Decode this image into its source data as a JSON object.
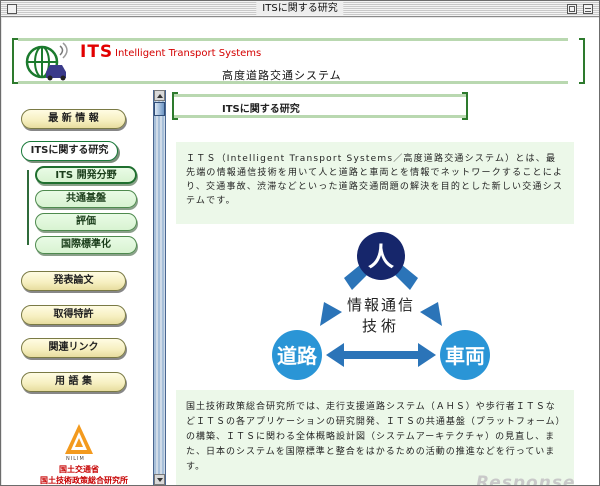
{
  "window": {
    "title": "ITSに関する研究"
  },
  "header": {
    "mark": "ITS",
    "full_name": "Intelligent Transport Systems",
    "subtitle": "高度道路交通システム"
  },
  "nav": {
    "items": [
      {
        "label": "最 新 情 報"
      },
      {
        "label": "ITSに関する研究"
      },
      {
        "label": "発表論文"
      },
      {
        "label": "取得特許"
      },
      {
        "label": "関連リンク"
      },
      {
        "label": "用 語 集"
      }
    ],
    "sub_items": [
      {
        "label": "ITS 開発分野"
      },
      {
        "label": "共通基盤"
      },
      {
        "label": "評価"
      },
      {
        "label": "国際標準化"
      }
    ],
    "org": {
      "logo_text": "NILIM",
      "line1": "国土交通省",
      "line2": "国土技術政策総合研究所"
    }
  },
  "main": {
    "section_title": "ITSに関する研究",
    "intro": "ＩＴＳ（Intelligent Transport Systems／高度道路交通システム）とは、最先端の情報通信技術を用いて人と道路と車両とを情報でネットワークすることにより、交通事故、渋滞などといった道路交通問題の解決を目的とした新しい交通システムです。",
    "diagram": {
      "top": "人",
      "left": "道路",
      "right": "車両",
      "center_line1": "情報通信",
      "center_line2": "技術",
      "colors": {
        "top": "#16266b",
        "sides": "#2a95d6",
        "arrows": "#2b74b8"
      }
    },
    "description": "国土技術政策総合研究所では、走行支援道路システム（ＡＨＳ）や歩行者ＩＴＳなどＩＴＳの各アプリケーションの研究開発、ＩＴＳの共通基盤（プラットフォーム）の構築、ＩＴＳに関わる全体概略設計図（システムアーキテクチャ）の見直し、また、日本のシステムを国際標準と整合をはかるための活動の推進などを行っています。"
  },
  "watermark": "Response",
  "colors": {
    "brand_red": "#e20000",
    "frame_green": "#2d7a2d",
    "panel_bg": "#ecf8e9"
  }
}
